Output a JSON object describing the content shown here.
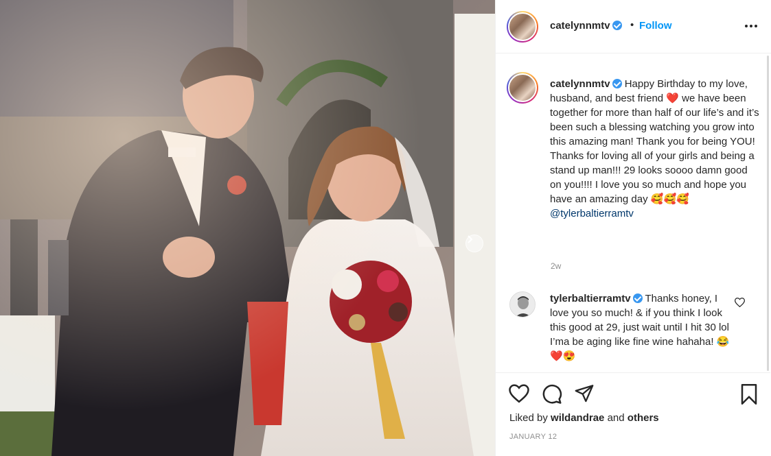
{
  "post": {
    "username": "catelynnmtv",
    "follow_label": "Follow",
    "dot": "•",
    "caption_text": "Happy Birthday to my love, husband, and best friend ❤️ we have been together for more than half of our life’s and it’s been such a blessing watching you grow into this amazing man! Thank you for being YOU! Thanks for loving all of your girls and being a stand up man!!! 29 looks soooo damn good on you!!!! I love you so much and hope you have an amazing day",
    "caption_emojis": "🥰🥰🥰",
    "caption_mention": "@tylerbaltierramtv",
    "caption_age": "2w"
  },
  "reply": {
    "username": "tylerbaltierramtv",
    "text": "Thanks honey, I love you so much! & if you think I look this good at 29, just wait until I hit 30 lol I’ma be aging like fine wine hahaha!",
    "emoji": "😂",
    "trailing_emojis": "❤️😍"
  },
  "likes": {
    "prefix": "Liked by",
    "user": "wildandrae",
    "joiner": "and",
    "others": "others"
  },
  "date": "JANUARY 12",
  "icons": [
    "more-options-icon",
    "verified-badge-icon",
    "heart-icon",
    "comment-icon",
    "share-icon",
    "bookmark-icon",
    "chevron-right-icon"
  ],
  "colors": {
    "accent": "#0095f6",
    "verified": "#3897f0",
    "text": "#262626",
    "muted": "#8e8e8e",
    "mention": "#00376b"
  }
}
